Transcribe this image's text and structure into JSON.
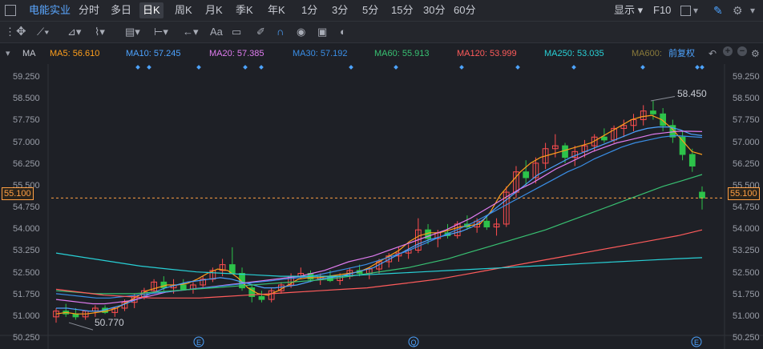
{
  "topbar": {
    "stock_name": "电能实业",
    "periods": [
      "分时",
      "多日",
      "日K",
      "周K",
      "月K",
      "季K",
      "年K",
      "1分",
      "3分",
      "5分",
      "15分",
      "30分",
      "60分"
    ],
    "active_period": "日K",
    "display_label": "显示",
    "f10_label": "F10"
  },
  "toolbar": {
    "text_tool_label": "Aa"
  },
  "ma_bar": {
    "prefix": "MA",
    "items": [
      {
        "label": "MA5: 56.610",
        "color": "#ff9f1c"
      },
      {
        "label": "MA10: 57.245",
        "color": "#4da3ff"
      },
      {
        "label": "MA20: 57.385",
        "color": "#e07cf0"
      },
      {
        "label": "MA30: 57.192",
        "color": "#3a8ee6"
      },
      {
        "label": "MA60: 55.913",
        "color": "#38c172"
      },
      {
        "label": "MA120: 53.999",
        "color": "#ff5b5b"
      },
      {
        "label": "MA250: 53.035",
        "color": "#28d0d6"
      },
      {
        "label": "MA600:",
        "color": "#8a7a3a"
      }
    ],
    "adjust_label": "前复权"
  },
  "axis": {
    "ticks": [
      "59.250",
      "58.500",
      "57.750",
      "57.000",
      "56.250",
      "55.500",
      "54.750",
      "54.000",
      "53.250",
      "52.500",
      "51.750",
      "51.000",
      "50.250"
    ]
  },
  "annotations": {
    "high_label": "58.450",
    "low_label": "50.770",
    "current_price": "55.100"
  },
  "event_markers": [
    "E",
    "Q",
    "E"
  ],
  "colors": {
    "up": "#ff4d4f",
    "down": "#2dc34a",
    "background": "#1e2026"
  },
  "chart_data": {
    "type": "candlestick",
    "ylim": [
      50.25,
      59.25
    ],
    "candles": [
      [
        51.0,
        51.3,
        50.8,
        51.2
      ],
      [
        51.2,
        51.45,
        51.0,
        51.1
      ],
      [
        51.1,
        51.3,
        50.9,
        51.0
      ],
      [
        51.0,
        51.2,
        50.9,
        51.2
      ],
      [
        51.2,
        51.4,
        51.0,
        51.3
      ],
      [
        51.3,
        51.4,
        51.1,
        51.15
      ],
      [
        51.15,
        51.35,
        51.0,
        51.3
      ],
      [
        51.3,
        51.6,
        51.2,
        51.5
      ],
      [
        51.5,
        51.8,
        51.3,
        51.7
      ],
      [
        51.7,
        52.0,
        51.6,
        51.9
      ],
      [
        51.9,
        52.3,
        51.8,
        52.2
      ],
      [
        52.2,
        52.4,
        51.9,
        52.0
      ],
      [
        52.0,
        52.3,
        51.8,
        52.1
      ],
      [
        52.1,
        52.3,
        51.9,
        51.95
      ],
      [
        51.95,
        52.2,
        51.8,
        52.1
      ],
      [
        52.1,
        52.4,
        52.0,
        52.3
      ],
      [
        52.3,
        52.7,
        52.2,
        52.6
      ],
      [
        52.6,
        53.0,
        52.4,
        52.8
      ],
      [
        52.8,
        53.4,
        52.6,
        52.5
      ],
      [
        52.5,
        52.7,
        51.9,
        52.0
      ],
      [
        52.0,
        52.1,
        51.5,
        51.7
      ],
      [
        51.7,
        51.9,
        51.5,
        51.6
      ],
      [
        51.6,
        52.0,
        51.5,
        51.9
      ],
      [
        51.9,
        52.2,
        51.8,
        52.1
      ],
      [
        52.1,
        52.5,
        52.0,
        52.4
      ],
      [
        52.4,
        52.7,
        52.3,
        52.5
      ],
      [
        52.5,
        52.6,
        52.2,
        52.3
      ],
      [
        52.3,
        52.5,
        52.1,
        52.4
      ],
      [
        52.4,
        52.6,
        52.2,
        52.25
      ],
      [
        52.25,
        52.5,
        52.1,
        52.4
      ],
      [
        52.4,
        52.7,
        52.3,
        52.6
      ],
      [
        52.6,
        52.8,
        52.4,
        52.5
      ],
      [
        52.5,
        52.7,
        52.3,
        52.65
      ],
      [
        52.65,
        53.0,
        52.5,
        52.9
      ],
      [
        52.9,
        53.2,
        52.7,
        53.1
      ],
      [
        53.1,
        53.4,
        52.9,
        53.2
      ],
      [
        53.2,
        53.5,
        53.0,
        53.3
      ],
      [
        53.3,
        54.4,
        53.2,
        54.0
      ],
      [
        54.0,
        54.2,
        53.5,
        53.7
      ],
      [
        53.7,
        54.0,
        53.4,
        53.9
      ],
      [
        53.9,
        54.2,
        53.7,
        53.8
      ],
      [
        53.8,
        54.3,
        53.7,
        54.2
      ],
      [
        54.2,
        54.5,
        54.0,
        54.1
      ],
      [
        54.1,
        54.4,
        53.9,
        54.3
      ],
      [
        54.3,
        54.5,
        54.0,
        54.1
      ],
      [
        54.1,
        54.4,
        53.8,
        54.2
      ],
      [
        54.2,
        55.5,
        54.1,
        55.3
      ],
      [
        55.3,
        56.2,
        55.1,
        56.0
      ],
      [
        56.0,
        56.4,
        55.5,
        55.8
      ],
      [
        55.8,
        56.5,
        55.6,
        56.3
      ],
      [
        56.3,
        57.0,
        56.1,
        56.8
      ],
      [
        56.8,
        57.3,
        56.5,
        56.9
      ],
      [
        56.9,
        57.0,
        56.3,
        56.5
      ],
      [
        56.5,
        56.9,
        56.2,
        56.7
      ],
      [
        56.7,
        57.1,
        56.5,
        56.9
      ],
      [
        56.9,
        57.3,
        56.7,
        57.2
      ],
      [
        57.2,
        57.5,
        57.0,
        57.1
      ],
      [
        57.1,
        57.6,
        57.0,
        57.5
      ],
      [
        57.5,
        57.8,
        57.2,
        57.6
      ],
      [
        57.6,
        58.0,
        57.4,
        57.8
      ],
      [
        57.8,
        58.3,
        57.6,
        58.1
      ],
      [
        58.1,
        58.45,
        57.8,
        58.0
      ],
      [
        58.0,
        58.2,
        57.4,
        57.6
      ],
      [
        57.6,
        57.8,
        57.0,
        57.2
      ],
      [
        57.2,
        57.4,
        56.4,
        56.6
      ],
      [
        56.6,
        56.8,
        56.0,
        56.2
      ],
      [
        55.3,
        55.5,
        54.7,
        55.1
      ]
    ],
    "series": [
      {
        "name": "MA5",
        "values": [
          51.1,
          51.15,
          51.1,
          51.1,
          51.15,
          51.2,
          51.3,
          51.5,
          51.7,
          51.9,
          52.0,
          52.1,
          52.1,
          52.15,
          52.3,
          52.5,
          52.65,
          52.6,
          52.35,
          52.0,
          51.8,
          51.75,
          51.9,
          52.1,
          52.3,
          52.35,
          52.35,
          52.4,
          52.45,
          52.5,
          52.55,
          52.7,
          52.9,
          53.1,
          53.3,
          53.6,
          53.8,
          53.9,
          53.9,
          54.0,
          54.1,
          54.15,
          54.2,
          54.6,
          55.2,
          55.6,
          56.0,
          56.3,
          56.5,
          56.6,
          56.7,
          56.8,
          56.9,
          57.0,
          57.2,
          57.4,
          57.6,
          57.8,
          57.9,
          57.95,
          57.8,
          57.5,
          57.1,
          56.7,
          56.6
        ]
      },
      {
        "name": "MA10",
        "values": [
          51.3,
          51.3,
          51.25,
          51.2,
          51.2,
          51.3,
          51.4,
          51.55,
          51.7,
          51.85,
          52.0,
          52.1,
          52.2,
          52.25,
          52.3,
          52.35,
          52.3,
          52.2,
          52.1,
          52.0,
          52.0,
          52.05,
          52.1,
          52.2,
          52.3,
          52.35,
          52.4,
          52.5,
          52.6,
          52.7,
          52.9,
          53.1,
          53.3,
          53.5,
          53.65,
          53.75,
          53.85,
          53.95,
          54.1,
          54.35,
          54.7,
          55.0,
          55.3,
          55.6,
          55.9,
          56.1,
          56.3,
          56.5,
          56.65,
          56.8,
          56.95,
          57.1,
          57.25,
          57.4,
          57.5,
          57.55,
          57.55,
          57.45,
          57.3,
          57.25
        ]
      },
      {
        "name": "MA20",
        "values": [
          51.6,
          51.55,
          51.5,
          51.45,
          51.45,
          51.5,
          51.55,
          51.65,
          51.75,
          51.85,
          51.9,
          51.95,
          52.0,
          52.05,
          52.1,
          52.15,
          52.2,
          52.25,
          52.3,
          52.35,
          52.4,
          52.5,
          52.6,
          52.75,
          52.9,
          53.0,
          53.1,
          53.25,
          53.4,
          53.55,
          53.7,
          53.85,
          54.0,
          54.2,
          54.4,
          54.65,
          54.9,
          55.15,
          55.4,
          55.6,
          55.85,
          56.1,
          56.3,
          56.5,
          56.7,
          56.85,
          57.0,
          57.1,
          57.2,
          57.3,
          57.35,
          57.4,
          57.4,
          57.39
        ]
      },
      {
        "name": "MA30",
        "values": [
          51.8,
          51.75,
          51.7,
          51.65,
          51.65,
          51.7,
          51.75,
          51.8,
          51.85,
          51.9,
          51.95,
          52.0,
          52.05,
          52.1,
          52.15,
          52.2,
          52.25,
          52.3,
          52.35,
          52.4,
          52.5,
          52.6,
          52.7,
          52.8,
          52.95,
          53.1,
          53.25,
          53.45,
          53.65,
          53.85,
          54.05,
          54.25,
          54.5,
          54.75,
          55.0,
          55.25,
          55.5,
          55.75,
          56.0,
          56.2,
          56.45,
          56.65,
          56.85,
          57.0,
          57.1,
          57.2,
          57.25,
          57.22,
          57.19
        ]
      },
      {
        "name": "MA60",
        "values": [
          51.9,
          51.85,
          51.8,
          51.8,
          51.8,
          51.85,
          51.9,
          51.95,
          52.0,
          52.05,
          52.1,
          52.15,
          52.2,
          52.25,
          52.3,
          52.4,
          52.5,
          52.6,
          52.7,
          52.85,
          53.0,
          53.2,
          53.4,
          53.6,
          53.8,
          54.0,
          54.25,
          54.5,
          54.75,
          55.0,
          55.25,
          55.5,
          55.7,
          55.91
        ]
      },
      {
        "name": "MA120",
        "values": [
          51.95,
          51.85,
          51.75,
          51.7,
          51.65,
          51.65,
          51.65,
          51.7,
          51.75,
          51.8,
          51.85,
          51.9,
          51.95,
          52.0,
          52.1,
          52.2,
          52.3,
          52.45,
          52.6,
          52.75,
          52.9,
          53.05,
          53.2,
          53.35,
          53.5,
          53.65,
          53.8,
          54.0
        ]
      },
      {
        "name": "MA250",
        "values": [
          53.2,
          53.05,
          52.9,
          52.75,
          52.65,
          52.55,
          52.5,
          52.45,
          52.4,
          52.4,
          52.4,
          52.45,
          52.5,
          52.55,
          52.6,
          52.65,
          52.7,
          52.75,
          52.8,
          52.85,
          52.9,
          52.95,
          53.0,
          53.04
        ]
      }
    ]
  }
}
